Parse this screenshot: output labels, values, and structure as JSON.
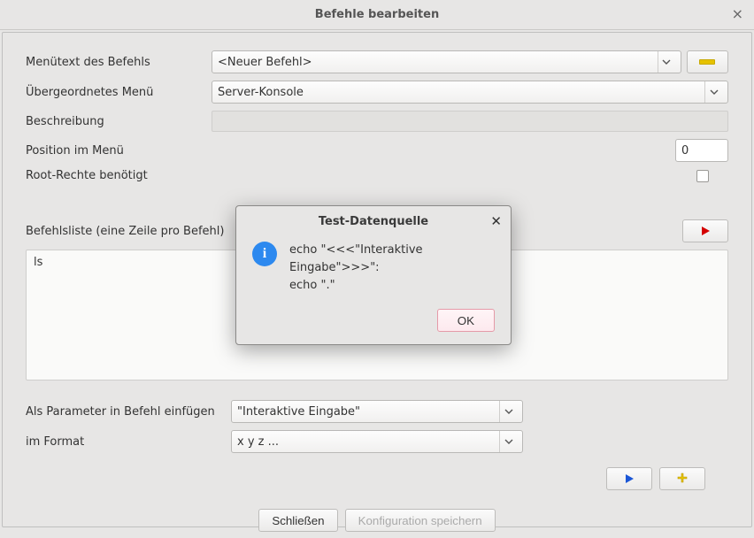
{
  "window": {
    "title": "Befehle bearbeiten"
  },
  "form": {
    "menu_text": {
      "label": "Menütext des Befehls",
      "value": "<Neuer Befehl>"
    },
    "parent_menu": {
      "label": "Übergeordnetes Menü",
      "value": "Server-Konsole"
    },
    "description": {
      "label": "Beschreibung",
      "value": ""
    },
    "position": {
      "label": "Position im Menü",
      "value": "0"
    },
    "root": {
      "label": "Root-Rechte benötigt",
      "checked": false
    },
    "command_list": {
      "label": "Befehlsliste (eine Zeile pro Befehl)",
      "value": "ls"
    },
    "as_param": {
      "label": "Als Parameter in Befehl einfügen",
      "value": "\"Interaktive Eingabe\""
    },
    "format": {
      "label": "im Format",
      "value": "x y z ..."
    }
  },
  "buttons": {
    "close": "Schließen",
    "save": "Konfiguration speichern"
  },
  "modal": {
    "title": "Test-Datenquelle",
    "line1": "echo \"<<<\"Interaktive Eingabe\">>>\":",
    "line2": "echo \".\"",
    "ok": "OK"
  }
}
